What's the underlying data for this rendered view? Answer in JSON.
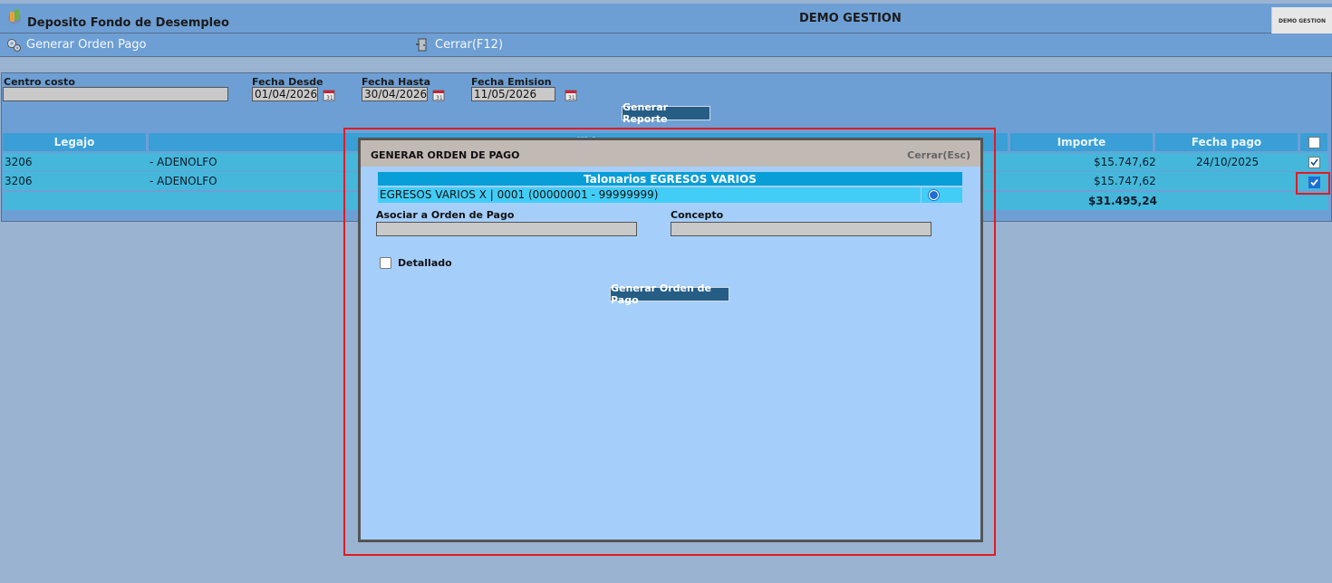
{
  "header": {
    "app_title": "Deposito Fondo de Desempleo",
    "company_title": "DEMO GESTION",
    "company_logo_text": "DEMO GESTION"
  },
  "toolbar": {
    "generate_label": "Generar Orden Pago",
    "close_label": "Cerrar(F12)"
  },
  "filters": {
    "centro_costo_label": "Centro costo",
    "centro_costo_value": "",
    "fecha_desde_label": "Fecha Desde",
    "fecha_desde_value": "01/04/2026",
    "fecha_hasta_label": "Fecha Hasta",
    "fecha_hasta_value": "30/04/2026",
    "fecha_emision_label": "Fecha Emision",
    "fecha_emision_value": "11/05/2026",
    "report_button": "Generar Reporte"
  },
  "table": {
    "columns": [
      "Legajo",
      "Apellido",
      "Importe",
      "Fecha pago"
    ],
    "rows": [
      {
        "legajo": "3206",
        "apellido": "- ADENOLFO",
        "importe": "$15.747,62",
        "fecha_pago": "24/10/2025",
        "checked": true
      },
      {
        "legajo": "3206",
        "apellido": "- ADENOLFO",
        "importe": "$15.747,62",
        "fecha_pago": "",
        "checked": true
      }
    ],
    "total": "$31.495,24"
  },
  "modal": {
    "title": "GENERAR ORDEN DE PAGO",
    "close_label": "Cerrar(Esc)",
    "talonarios_header": "Talonarios EGRESOS VARIOS",
    "talonario_option": "EGRESOS VARIOS X | 0001 (00000001 - 99999999)",
    "asociar_label": "Asociar a Orden de Pago",
    "asociar_value": "",
    "concepto_label": "Concepto",
    "concepto_value": "",
    "detallado_label": "Detallado",
    "generate_button": "Generar Orden de Pago"
  },
  "colors": {
    "background": "#99b3d1",
    "panel": "#6e9fd4",
    "table_header": "#3a9fd6",
    "row": "#45b7da",
    "modal_body": "#a5cffa",
    "highlight": "#e01b24"
  }
}
